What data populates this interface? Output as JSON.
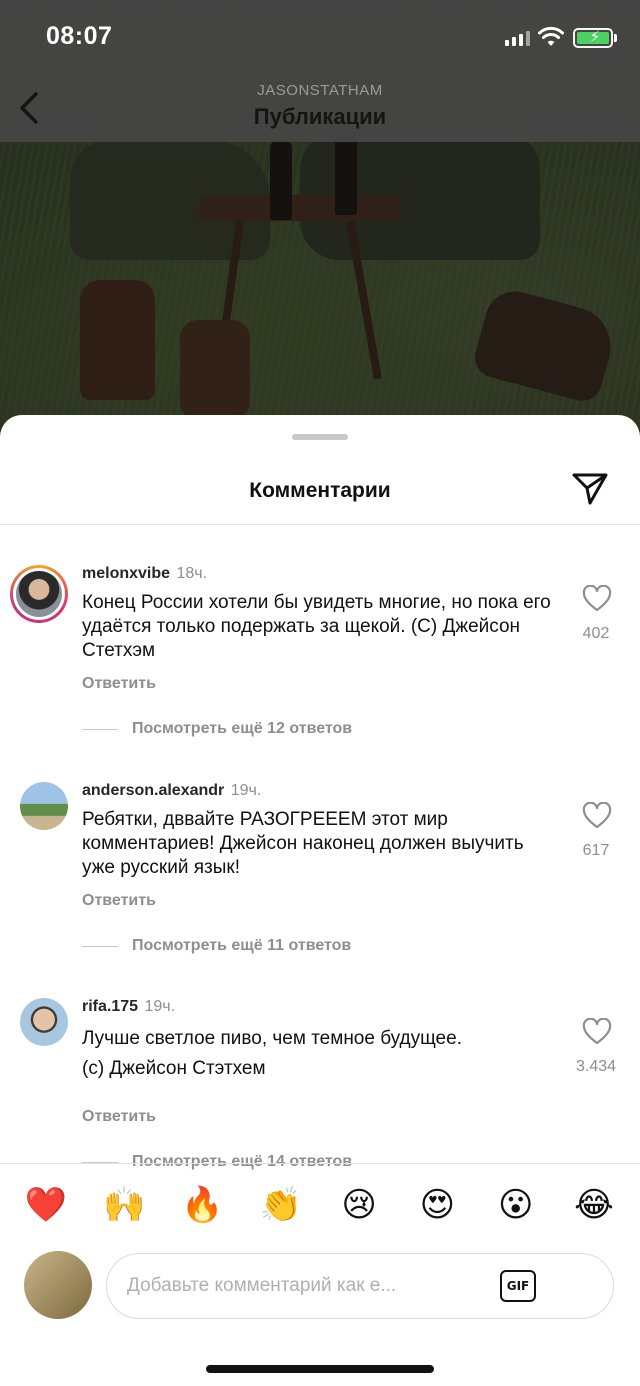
{
  "status": {
    "time": "08:07"
  },
  "header": {
    "account": "JASONSTATHAM",
    "title": "Публикации"
  },
  "sheet": {
    "title": "Комментарии"
  },
  "comments": [
    {
      "username": "melonxvibe",
      "ago": "18ч.",
      "text": "Конец России хотели бы увидеть многие, но пока его удаётся только подержать за щекой. (С) Джейсон Стетхэм",
      "reply": "Ответить",
      "likes": "402",
      "more": "Посмотреть ещё 12 ответов"
    },
    {
      "username": "anderson.alexandr",
      "ago": "19ч.",
      "text": "Ребятки, дввайте РАЗОГРЕЕЕМ этот мир комментариев! Джейсон наконец должен выучить уже русский язык!",
      "reply": "Ответить",
      "likes": "617",
      "more": "Посмотреть ещё 11 ответов"
    },
    {
      "username": "rifa.175",
      "ago": "19ч.",
      "text": "Лучше светлое пиво, чем темное будущее.\n(с) Джейсон Стэтхем",
      "reply": "Ответить",
      "likes": "3.434",
      "more": "Посмотреть ещё 14 ответов"
    }
  ],
  "emojis": [
    "❤️",
    "🙌",
    "🔥",
    "👏",
    "😢",
    "😍",
    "😮",
    "😂"
  ],
  "input": {
    "placeholder": "Добавьте комментарий как е...",
    "gif_label": "GIF"
  }
}
